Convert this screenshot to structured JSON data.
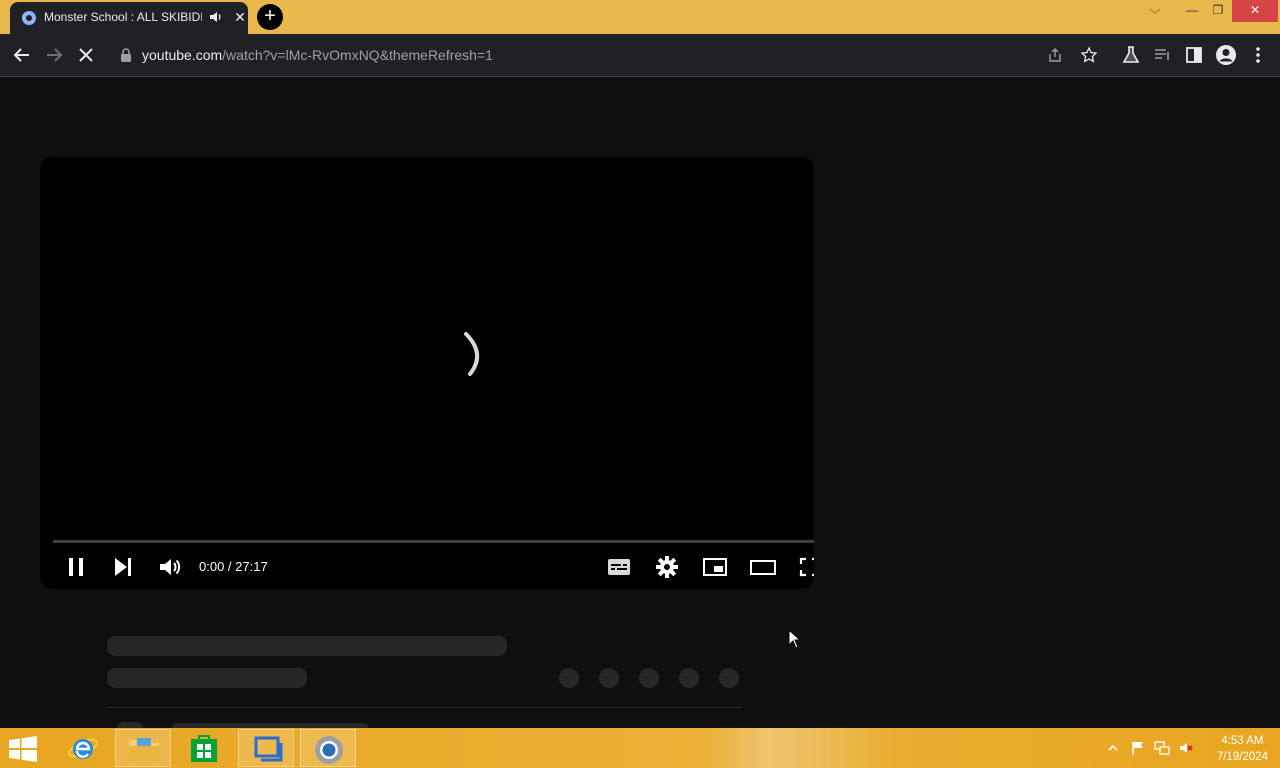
{
  "browser": {
    "tab": {
      "title": "Monster School : ALL SKIBIDI"
    },
    "new_tab_label": "+",
    "close_glyph": "✕",
    "window_controls": {
      "minimize": "—",
      "restore": "❐",
      "close": "✕"
    },
    "address": {
      "host": "youtube.com",
      "path": "/watch?v=lMc-RvOmxNQ&themeRefresh=1"
    }
  },
  "player": {
    "state": "loading",
    "current_time": "0:00",
    "duration": "27:17",
    "time_display": "0:00 / 27:17",
    "progress": 0.0,
    "controls": [
      "pause-icon",
      "next-icon",
      "volume-icon",
      "subtitles-icon",
      "settings-icon",
      "miniplayer-icon",
      "theater-icon",
      "fullscreen-icon"
    ]
  },
  "taskbar": {
    "apps": [
      "start-icon",
      "internet-explorer-icon",
      "file-explorer-icon",
      "store-icon",
      "app-icon",
      "chrome-icon"
    ],
    "clock": {
      "time": "4:53 AM",
      "date": "7/19/2024"
    }
  },
  "colors": {
    "tabbar": "#e8b84a",
    "toolbar": "#202124",
    "page_bg": "#0f0f0f",
    "player_bg": "#000000",
    "skeleton": "#272727",
    "taskbar": "#e8a620",
    "close_button": "#d64545"
  }
}
